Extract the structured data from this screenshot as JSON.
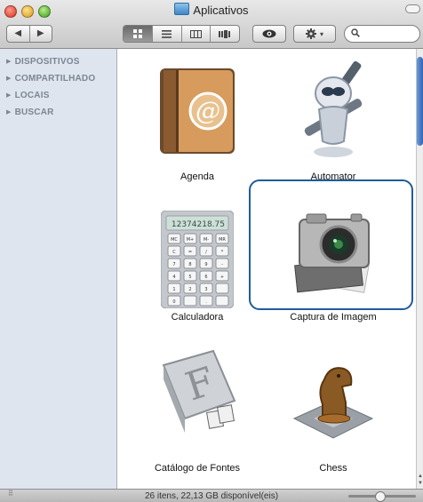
{
  "window": {
    "title": "Aplicativos"
  },
  "toolbar": {
    "back_label": "◀",
    "forward_label": "▶",
    "view_icons": [
      "icon-view-icon",
      "list-view-icon",
      "column-view-icon",
      "coverflow-view-icon"
    ],
    "quicklook_label": "◉",
    "action_label": "✱ ▾",
    "search_placeholder": ""
  },
  "sidebar": {
    "items": [
      {
        "label": "DISPOSITIVOS"
      },
      {
        "label": "COMPARTILHADO"
      },
      {
        "label": "LOCAIS"
      },
      {
        "label": "BUSCAR"
      }
    ]
  },
  "apps": [
    {
      "label": "Agenda",
      "icon": "address-book-icon"
    },
    {
      "label": "Automator",
      "icon": "automator-robot-icon"
    },
    {
      "label": "Calculadora",
      "icon": "calculator-icon",
      "display": "12374218.75"
    },
    {
      "label": "Captura de Imagem",
      "icon": "camera-icon",
      "selected": true
    },
    {
      "label": "Catálogo de Fontes",
      "icon": "font-book-icon"
    },
    {
      "label": "Chess",
      "icon": "chess-knight-icon"
    }
  ],
  "calculator_keys": [
    "MC",
    "M+",
    "M-",
    "MR",
    "C",
    "=",
    "/",
    "*",
    "7",
    "8",
    "9",
    "-",
    "4",
    "5",
    "6",
    "+",
    "1",
    "2",
    "3",
    "",
    "0",
    "",
    ".",
    ""
  ],
  "status": {
    "text": "26 itens, 22,13 GB disponível(eis)"
  },
  "colors": {
    "selection": "#1f5d9a",
    "sidebar_bg": "#dfe5ee",
    "sidebar_text": "#7b8694"
  }
}
